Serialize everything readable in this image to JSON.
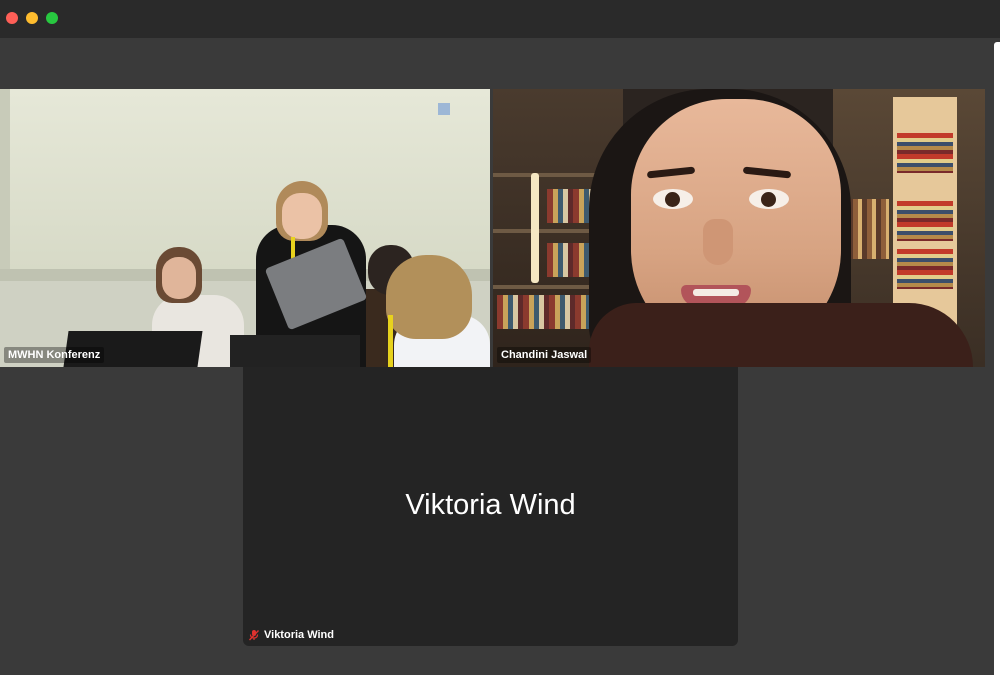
{
  "window": {
    "controls": [
      "close",
      "minimize",
      "zoom"
    ],
    "colors": {
      "close": "#fe5f57",
      "minimize": "#febc2e",
      "zoom": "#28c840"
    }
  },
  "participants": [
    {
      "name": "MWHN Konferenz",
      "video": "on",
      "active_speaker": true,
      "highlight_color": "#2fd14e"
    },
    {
      "name": "Chandini Jaswal",
      "video": "on",
      "active_speaker": false
    },
    {
      "name": "Viktoria Wind",
      "video": "off",
      "muted": true,
      "display_name": "Viktoria Wind",
      "icon": "mic-muted-icon",
      "icon_color": "#e0322f"
    }
  ]
}
